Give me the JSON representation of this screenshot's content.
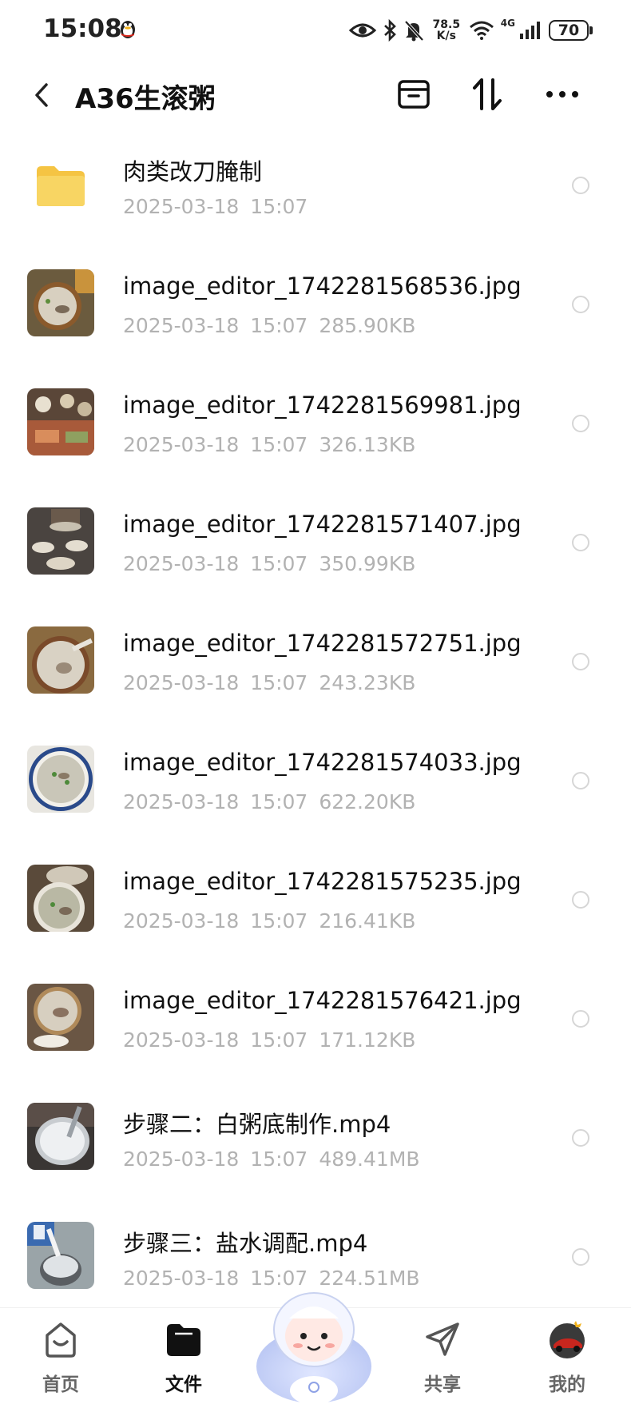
{
  "status_bar": {
    "time": "15:08",
    "net_speed_value": "78.5",
    "net_speed_unit": "K/s",
    "network_type": "4G",
    "battery": "70",
    "icons": [
      "qq-penguin-icon",
      "eye-icon",
      "bluetooth-icon",
      "bell-muted-icon",
      "wifi-icon",
      "signal-icon",
      "battery-icon"
    ]
  },
  "header": {
    "title": "A36生滚粥",
    "actions": [
      "archive-icon",
      "sort-icon",
      "more-icon"
    ]
  },
  "files": [
    {
      "name": "肉类改刀腌制",
      "date": "2025-03-18",
      "time": "15:07",
      "size": "",
      "type": "folder"
    },
    {
      "name": "image_editor_1742281568536.jpg",
      "date": "2025-03-18",
      "time": "15:07",
      "size": "285.90KB",
      "type": "image"
    },
    {
      "name": "image_editor_1742281569981.jpg",
      "date": "2025-03-18",
      "time": "15:07",
      "size": "326.13KB",
      "type": "image"
    },
    {
      "name": "image_editor_1742281571407.jpg",
      "date": "2025-03-18",
      "time": "15:07",
      "size": "350.99KB",
      "type": "image"
    },
    {
      "name": "image_editor_1742281572751.jpg",
      "date": "2025-03-18",
      "time": "15:07",
      "size": "243.23KB",
      "type": "image"
    },
    {
      "name": "image_editor_1742281574033.jpg",
      "date": "2025-03-18",
      "time": "15:07",
      "size": "622.20KB",
      "type": "image"
    },
    {
      "name": "image_editor_1742281575235.jpg",
      "date": "2025-03-18",
      "time": "15:07",
      "size": "216.41KB",
      "type": "image"
    },
    {
      "name": "image_editor_1742281576421.jpg",
      "date": "2025-03-18",
      "time": "15:07",
      "size": "171.12KB",
      "type": "image"
    },
    {
      "name": "步骤二：白粥底制作.mp4",
      "date": "2025-03-18",
      "time": "15:07",
      "size": "489.41MB",
      "type": "video"
    },
    {
      "name": "步骤三：盐水调配.mp4",
      "date": "2025-03-18",
      "time": "15:07",
      "size": "224.51MB",
      "type": "video"
    }
  ],
  "tab_bar": {
    "tabs": [
      {
        "label": "首页",
        "icon": "home-icon",
        "active": false
      },
      {
        "label": "文件",
        "icon": "folder-icon",
        "active": true
      },
      {
        "label": "共享",
        "icon": "share-icon",
        "active": false
      },
      {
        "label": "我的",
        "icon": "avatar-icon",
        "active": false
      }
    ]
  },
  "colors": {
    "meta_text": "#b2b2b2",
    "folder": "#f7cf5a",
    "active_tab": "#111111",
    "inactive_tab": "#666666"
  }
}
